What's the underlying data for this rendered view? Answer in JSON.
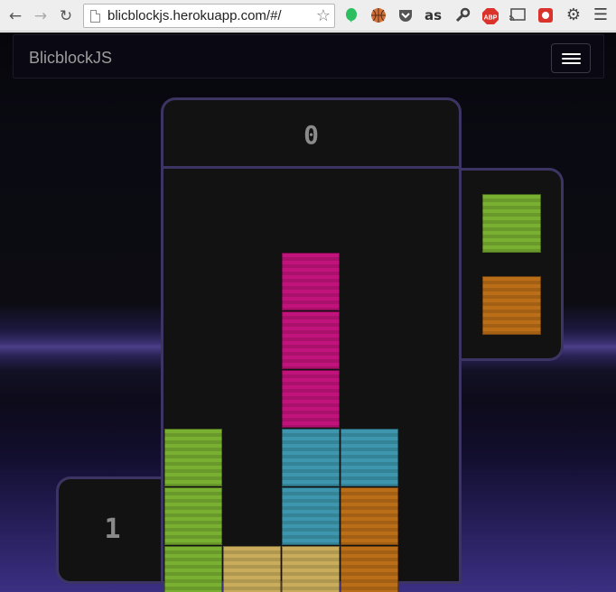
{
  "browser": {
    "url": "blicblockjs.herokuapp.com/#/",
    "extensions": [
      "evernote-icon",
      "basketball-icon",
      "pocket-icon",
      "lastfm-icon",
      "wrench-icon",
      "adblock-icon",
      "cast-icon",
      "record-icon",
      "gear-icon",
      "menu-icon"
    ],
    "abp_label": "ABP",
    "lastfm_label": "as"
  },
  "navbar": {
    "brand": "BlicblockJS"
  },
  "game": {
    "score": "0",
    "level": "1",
    "colors": {
      "green": "#7ab031",
      "tan": "#c9ad5c",
      "magenta": "#c2137c",
      "teal": "#3d96ad",
      "orange": "#bb6e18"
    },
    "queue": [
      "green",
      "orange"
    ],
    "board": [
      {
        "col": 2,
        "row": 3,
        "color": "magenta"
      },
      {
        "col": 2,
        "row": 4,
        "color": "magenta"
      },
      {
        "col": 2,
        "row": 5,
        "color": "magenta"
      },
      {
        "col": 0,
        "row": 6,
        "color": "green"
      },
      {
        "col": 2,
        "row": 6,
        "color": "teal"
      },
      {
        "col": 3,
        "row": 6,
        "color": "teal"
      },
      {
        "col": 0,
        "row": 7,
        "color": "green"
      },
      {
        "col": 2,
        "row": 7,
        "color": "teal"
      },
      {
        "col": 3,
        "row": 7,
        "color": "orange"
      },
      {
        "col": 0,
        "row": 8,
        "color": "green"
      },
      {
        "col": 1,
        "row": 8,
        "color": "tan"
      },
      {
        "col": 2,
        "row": 8,
        "color": "tan"
      },
      {
        "col": 3,
        "row": 8,
        "color": "orange"
      }
    ]
  }
}
